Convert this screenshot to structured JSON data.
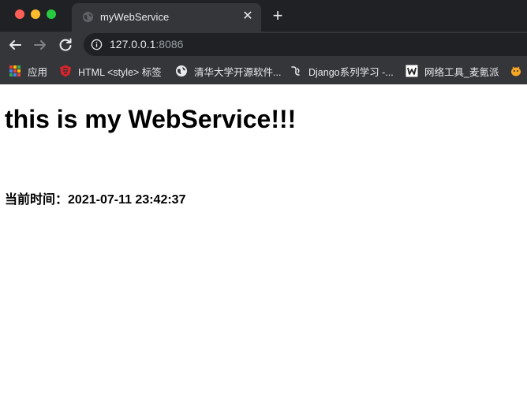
{
  "browser": {
    "tab": {
      "title": "myWebService",
      "close_glyph": "✕"
    },
    "new_tab_glyph": "+",
    "address": {
      "host": "127.0.0.1",
      "port": ":8086"
    },
    "bookmarks": [
      {
        "label": "应用",
        "icon": "apps-grid-icon"
      },
      {
        "label": "HTML <style> 标签",
        "icon": "w3-shield-icon"
      },
      {
        "label": "清华大学开源软件...",
        "icon": "globe-icon"
      },
      {
        "label": "Django系列学习 -...",
        "icon": "django-curl-icon"
      },
      {
        "label": "网络工具_麦氪派",
        "icon": "w-box-icon"
      },
      {
        "label": "",
        "icon": "orange-bug-icon"
      }
    ],
    "colors": {
      "tabstrip": "#202124",
      "toolbar": "#35363a",
      "text": "#e8eaed"
    }
  },
  "page": {
    "heading": "this is my WebService!!!",
    "time_label": "当前时间：",
    "time_value": "2021-07-11 23:42:37"
  }
}
